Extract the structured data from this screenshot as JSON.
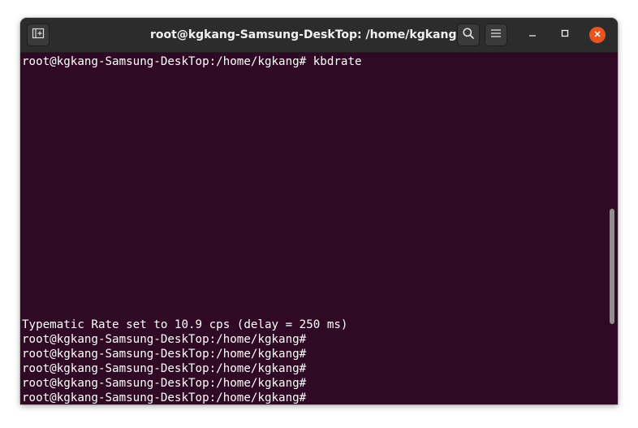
{
  "window": {
    "title": "root@kgkang-Samsung-DeskTop: /home/kgkang"
  },
  "icons": {
    "new_tab": "new-tab-icon",
    "search": "search-icon",
    "menu": "hamburger-menu-icon",
    "minimize": "minimize-icon",
    "maximize": "maximize-icon",
    "close": "close-icon"
  },
  "colors": {
    "terminal_background": "#300a24",
    "titlebar": "#2c2c2c",
    "close_button": "#e95420",
    "text": "#ffffff"
  },
  "terminal": {
    "lines": [
      "root@kgkang-Samsung-DeskTop:/home/kgkang# kbdrate",
      "Typematic Rate set to 10.9 cps (delay = 250 ms)",
      "root@kgkang-Samsung-DeskTop:/home/kgkang#",
      "root@kgkang-Samsung-DeskTop:/home/kgkang#",
      "root@kgkang-Samsung-DeskTop:/home/kgkang#",
      "root@kgkang-Samsung-DeskTop:/home/kgkang#",
      "root@kgkang-Samsung-DeskTop:/home/kgkang#"
    ]
  }
}
